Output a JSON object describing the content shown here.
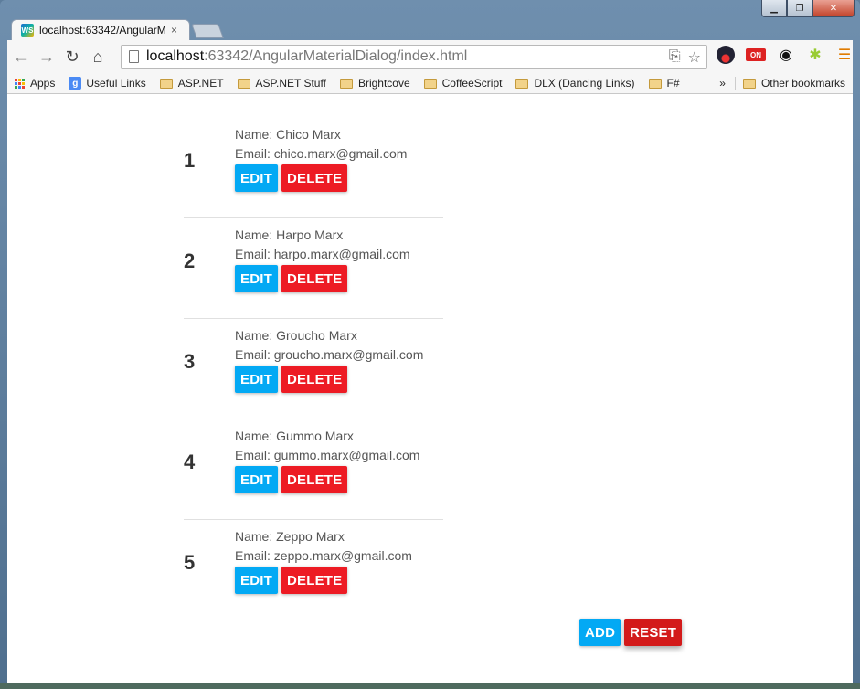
{
  "browser": {
    "tab_title": "localhost:63342/AngularM",
    "tab_close": "×",
    "favicon_text": "WS",
    "url_host": "localhost",
    "url_rest": ":63342/AngularMaterialDialog/index.html",
    "window_controls": {
      "minimize": "▁",
      "maximize": "❐",
      "close": "✕"
    },
    "nav": {
      "back": "←",
      "forward": "→",
      "reload": "↻",
      "home": "⌂"
    },
    "omnibox_icons": {
      "page_action": "⎘",
      "star": "☆"
    },
    "extensions": {
      "on_label": "ON",
      "eye": "◉",
      "android": "✱",
      "menu": "☰"
    }
  },
  "bookmarks": {
    "items": [
      {
        "label": "Apps",
        "type": "apps"
      },
      {
        "label": "Useful Links",
        "type": "google",
        "glyph": "g"
      },
      {
        "label": "ASP.NET",
        "type": "folder"
      },
      {
        "label": "ASP.NET Stuff",
        "type": "folder"
      },
      {
        "label": "Brightcove",
        "type": "folder"
      },
      {
        "label": "CoffeeScript",
        "type": "folder"
      },
      {
        "label": "DLX (Dancing Links)",
        "type": "folder"
      },
      {
        "label": "F#",
        "type": "folder"
      }
    ],
    "more": "»",
    "other": "Other bookmarks"
  },
  "app": {
    "edit_label": "EDIT",
    "delete_label": "DELETE",
    "add_label": "ADD",
    "reset_label": "RESET",
    "people": [
      {
        "num": "1",
        "name": "Name: Chico Marx",
        "email": "Email: chico.marx@gmail.com"
      },
      {
        "num": "2",
        "name": "Name: Harpo Marx",
        "email": "Email: harpo.marx@gmail.com"
      },
      {
        "num": "3",
        "name": "Name: Groucho Marx",
        "email": "Email: groucho.marx@gmail.com"
      },
      {
        "num": "4",
        "name": "Name: Gummo Marx",
        "email": "Email: gummo.marx@gmail.com"
      },
      {
        "num": "5",
        "name": "Name: Zeppo Marx",
        "email": "Email: zeppo.marx@gmail.com"
      }
    ]
  },
  "colors": {
    "edit_button": "#03a9f4",
    "delete_button": "#ed1b24",
    "reset_button": "#d31a1a"
  }
}
